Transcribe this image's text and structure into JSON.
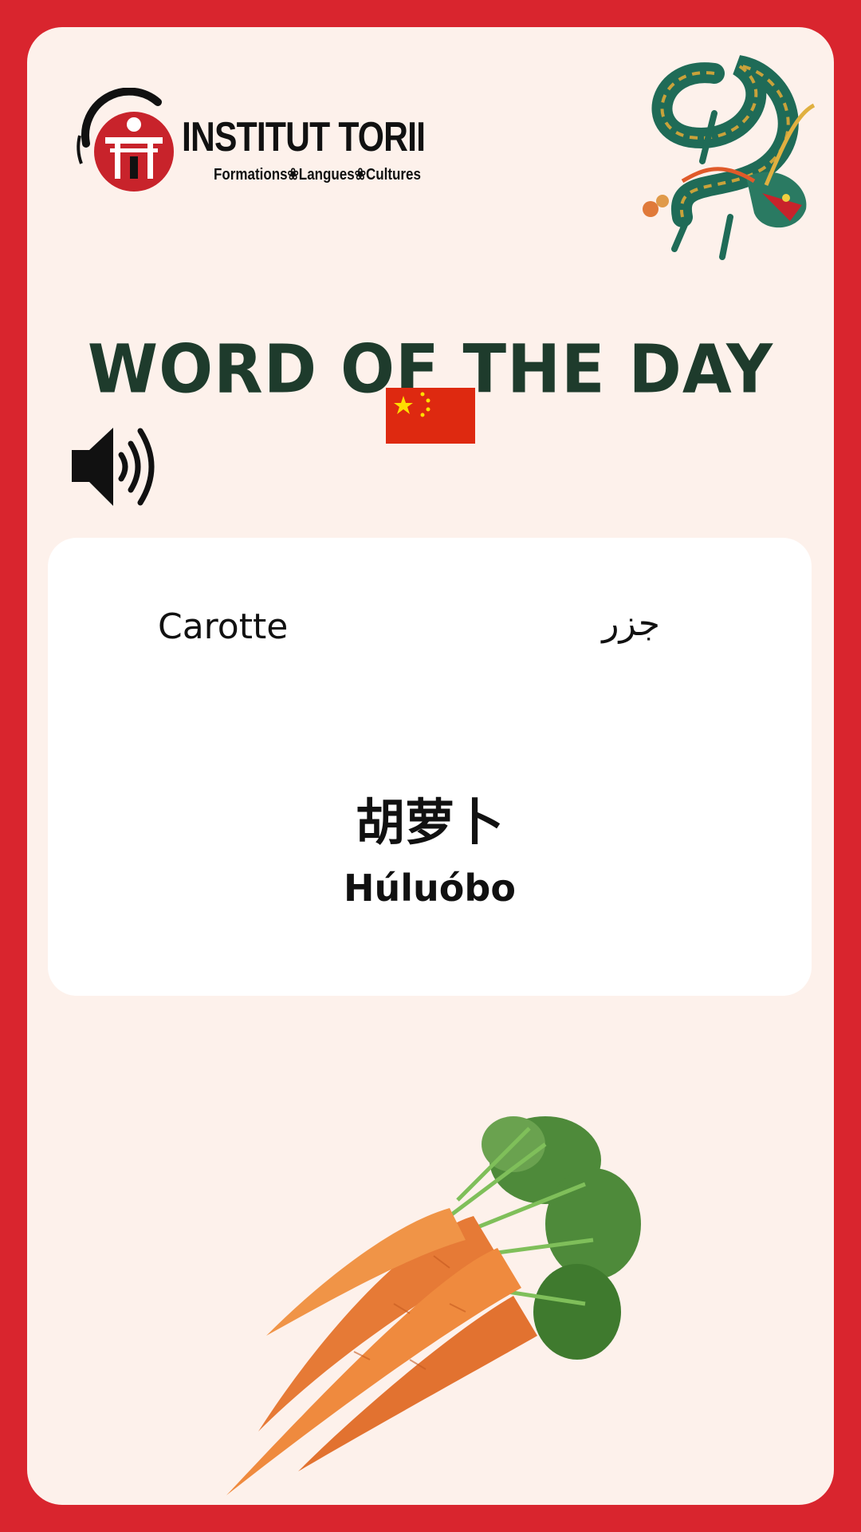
{
  "logo": {
    "name": "INSTITUT TORII",
    "tagline": "Formations❀Langues❀Cultures"
  },
  "heading": "WORD OF THE DAY",
  "flag": "china-flag",
  "audio_icon": "speaker-icon",
  "word": {
    "french": "Carotte",
    "arabic": "جزر",
    "chinese": "胡萝卜",
    "pinyin": "Húluóbo"
  },
  "colors": {
    "frame": "#d9252e",
    "background": "#fdf1eb",
    "heading": "#1e3b2c",
    "panel": "#ffffff"
  }
}
